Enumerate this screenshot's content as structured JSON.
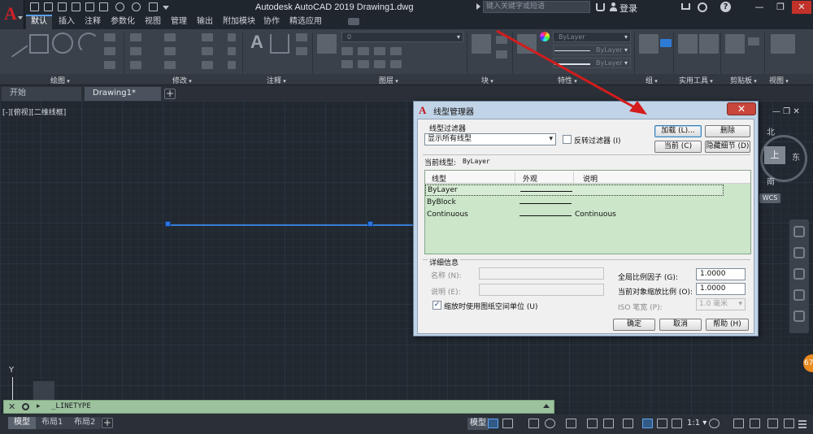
{
  "title_bar": {
    "window_title": "Autodesk AutoCAD 2019    Drawing1.dwg",
    "search_placeholder": "键入关键字或短语",
    "signin_label": "登录",
    "help_label": "?",
    "minimize_label": "—",
    "restore_label": "❐",
    "close_label": "✕"
  },
  "ribbon": {
    "tabs": [
      "默认",
      "插入",
      "注释",
      "参数化",
      "视图",
      "管理",
      "输出",
      "附加模块",
      "协作",
      "精选应用"
    ],
    "active_tab": "默认",
    "panels": [
      "绘图",
      "修改",
      "注释",
      "图层",
      "块",
      "特性",
      "组",
      "实用工具",
      "剪贴板",
      "视图"
    ],
    "layer_value": "0",
    "properties": {
      "color_value": "ByLayer",
      "linetype_value": "ByLayer",
      "lineweight_value": "ByLayer"
    }
  },
  "file_tabs": {
    "start_label": "开始",
    "drawing_label": "Drawing1*",
    "new_tab_label": "+"
  },
  "viewport": {
    "label": "[-][俯视][二维线框]",
    "controls_label": "— ❐ ✕",
    "compass": {
      "north": "北",
      "east": "东",
      "south": "南",
      "face": "上"
    },
    "ucs_y_label": "Y",
    "wcs_label": "WCS",
    "notify_count": "67"
  },
  "command_line": {
    "prompt_icon": "▸",
    "text": "_LINETYPE"
  },
  "status_bar": {
    "layout_tabs": [
      "模型",
      "布局1",
      "布局2"
    ],
    "add_tab_label": "+",
    "model_label": "模型",
    "scale_label": "1:1 ▾"
  },
  "linetype_dialog": {
    "title": "线型管理器",
    "close_label": "✕",
    "filter_label": "线型过滤器",
    "filter_value": "显示所有线型",
    "invert_filter_label": "反转过滤器 (I)",
    "invert_filter_checked": false,
    "buttons": {
      "load": "加载 (L)...",
      "delete": "删除",
      "current": "当前 (C)",
      "hide_details": "隐藏细节 (D)",
      "ok": "确定",
      "cancel": "取消",
      "help": "帮助 (H)"
    },
    "current_linetype_label": "当前线型:",
    "current_linetype_value": "ByLayer",
    "columns": [
      "线型",
      "外观",
      "说明"
    ],
    "rows": [
      {
        "name": "ByLayer",
        "has_sample": true,
        "description": ""
      },
      {
        "name": "ByBlock",
        "has_sample": true,
        "description": ""
      },
      {
        "name": "Continuous",
        "has_sample": true,
        "description": "Continuous"
      }
    ],
    "selected_row": 0,
    "details": {
      "section_label": "详细信息",
      "name_label": "名称 (N):",
      "description_label": "说明 (E):",
      "paper_units_label": "缩放时使用图纸空间单位 (U)",
      "paper_units_checked": true,
      "global_scale_label": "全局比例因子 (G):",
      "global_scale_value": "1.0000",
      "object_scale_label": "当前对象缩放比例 (O):",
      "object_scale_value": "1.0000",
      "iso_pen_label": "ISO 笔宽 (P):",
      "iso_pen_value": "1.0 毫米"
    }
  },
  "colors": {
    "line_color": "#3a7fd8",
    "arrow_color": "#d41c1c",
    "list_background": "#cbe6c9",
    "command_line_background": "#9cc19d"
  }
}
